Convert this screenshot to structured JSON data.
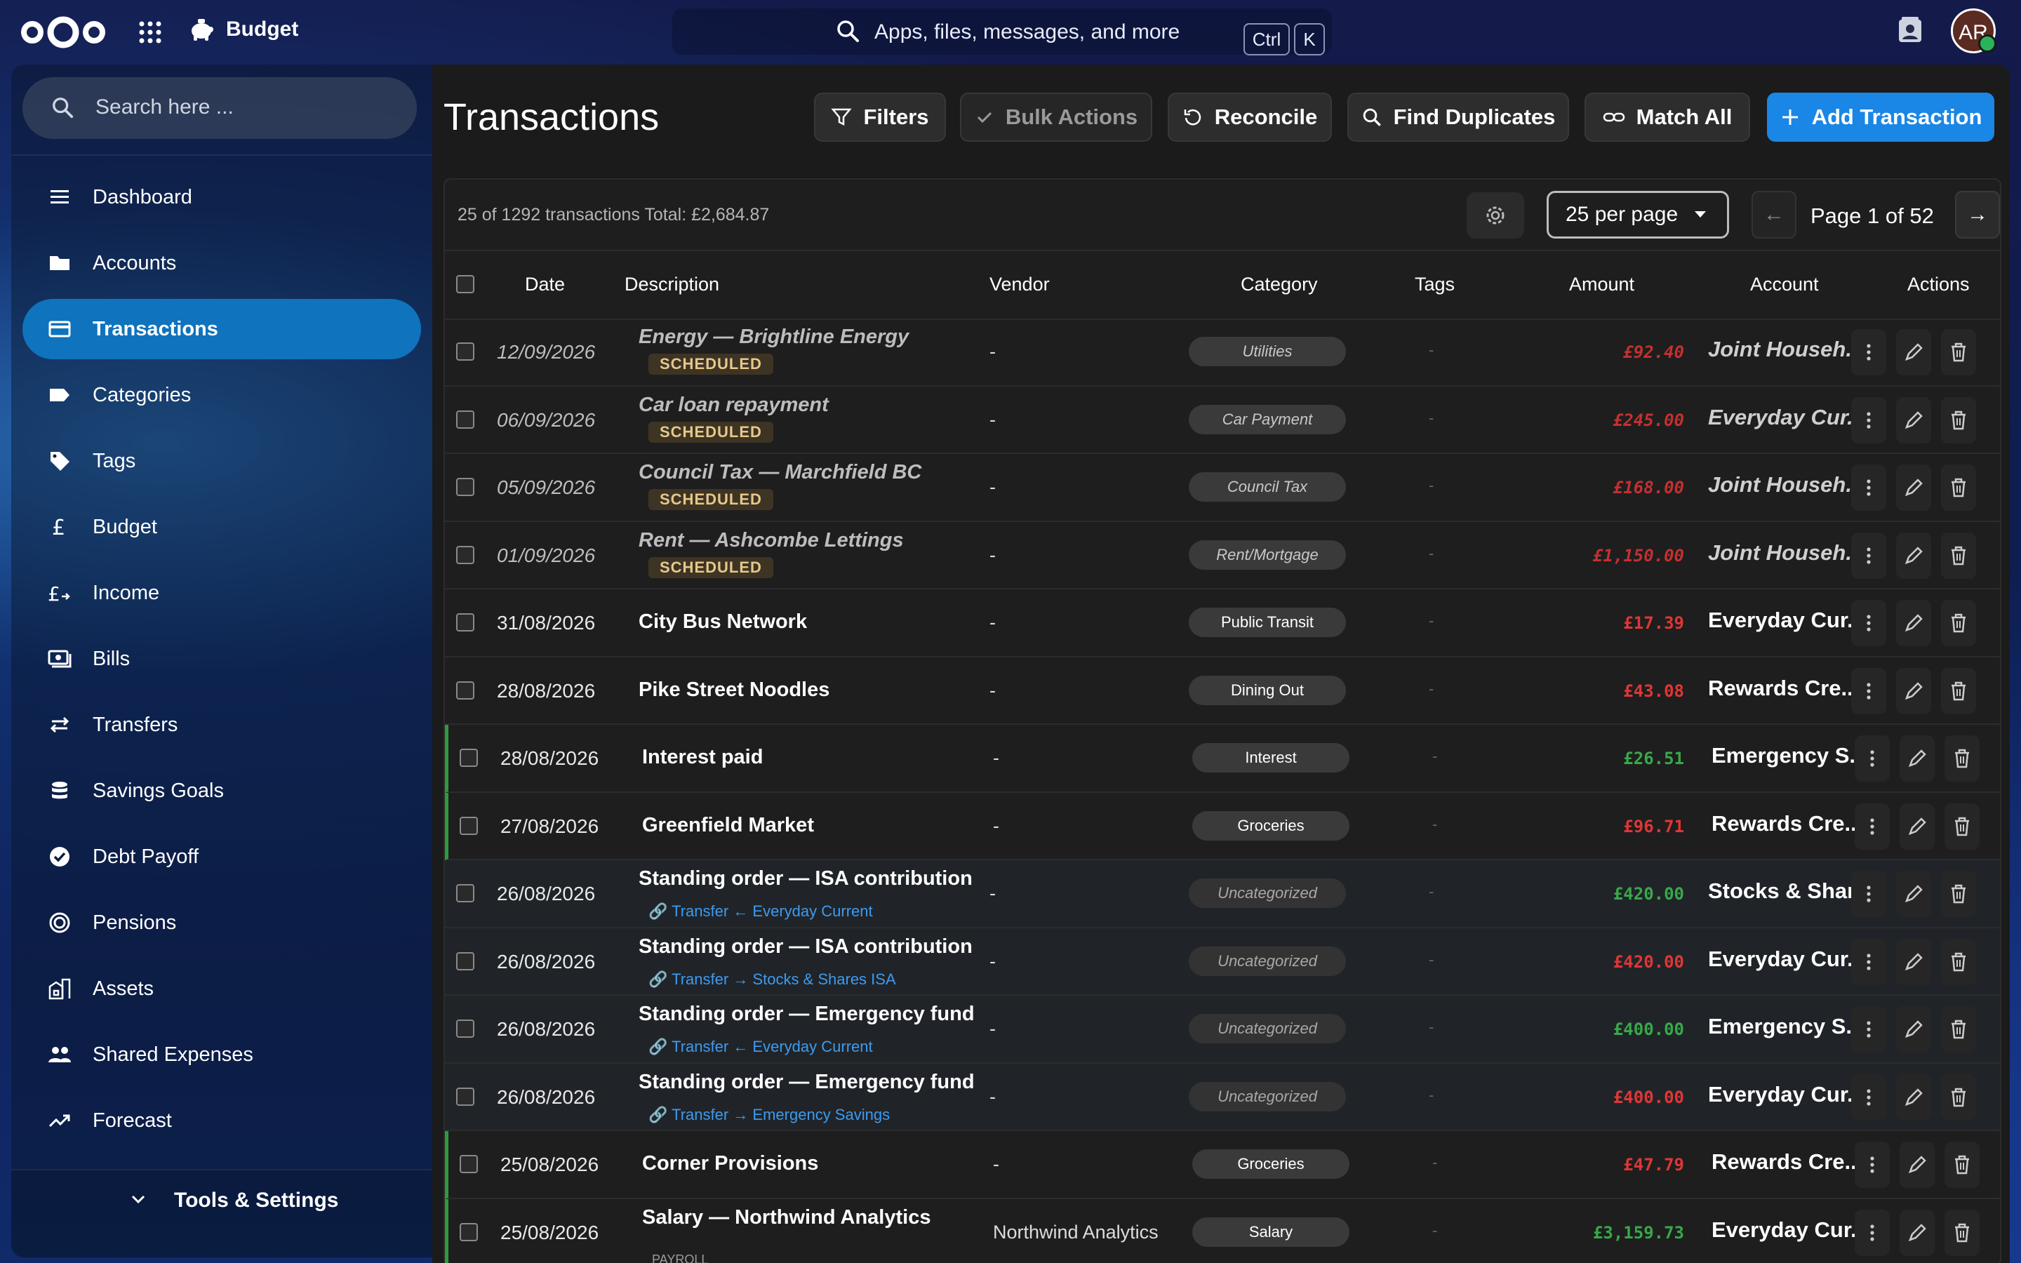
{
  "app": {
    "name": "Budget"
  },
  "global_search": {
    "placeholder": "Apps, files, messages, and more",
    "kbd1": "Ctrl",
    "kbd2": "K"
  },
  "user": {
    "initials": "AR"
  },
  "sidebar": {
    "search_placeholder": "Search here ...",
    "items": [
      {
        "label": "Dashboard",
        "icon": "menu-icon"
      },
      {
        "label": "Accounts",
        "icon": "folder-icon"
      },
      {
        "label": "Transactions",
        "icon": "card-icon",
        "active": true
      },
      {
        "label": "Categories",
        "icon": "label-icon"
      },
      {
        "label": "Tags",
        "icon": "tag-icon"
      },
      {
        "label": "Budget",
        "icon": "pound-icon"
      },
      {
        "label": "Income",
        "icon": "pound-arrow-icon"
      },
      {
        "label": "Bills",
        "icon": "cash-icon"
      },
      {
        "label": "Transfers",
        "icon": "swap-icon"
      },
      {
        "label": "Savings Goals",
        "icon": "coins-icon"
      },
      {
        "label": "Debt Payoff",
        "icon": "check-circle-icon"
      },
      {
        "label": "Pensions",
        "icon": "ring-icon"
      },
      {
        "label": "Assets",
        "icon": "building-icon"
      },
      {
        "label": "Shared Expenses",
        "icon": "people-icon"
      },
      {
        "label": "Forecast",
        "icon": "trend-icon"
      }
    ],
    "footer_label": "Tools & Settings"
  },
  "main": {
    "title": "Transactions",
    "buttons": {
      "filters": "Filters",
      "bulk": "Bulk Actions",
      "reconcile": "Reconcile",
      "duplicates": "Find Duplicates",
      "match": "Match All",
      "add": "Add Transaction"
    },
    "summary": "25 of 1292 transactions   Total: £2,684.87",
    "per_page": "25 per page",
    "page_text": "Page 1 of 52",
    "prev": "←",
    "next": "→",
    "columns": {
      "date": "Date",
      "description": "Description",
      "vendor": "Vendor",
      "category": "Category",
      "tags": "Tags",
      "amount": "Amount",
      "account": "Account",
      "actions": "Actions"
    }
  },
  "rows": [
    {
      "date": "12/09/2026",
      "desc": "Energy — Brightline Energy",
      "badge": "SCHEDULED",
      "vendor": "-",
      "category": "Utilities",
      "tags": "-",
      "amount": "£92.40",
      "sign": "neg",
      "account": "Joint Househ...",
      "kind": "sched"
    },
    {
      "date": "06/09/2026",
      "desc": "Car loan repayment",
      "badge": "SCHEDULED",
      "vendor": "-",
      "category": "Car Payment",
      "tags": "-",
      "amount": "£245.00",
      "sign": "neg",
      "account": "Everyday Cur...",
      "kind": "sched"
    },
    {
      "date": "05/09/2026",
      "desc": "Council Tax — Marchfield BC",
      "badge": "SCHEDULED",
      "vendor": "-",
      "category": "Council Tax",
      "tags": "-",
      "amount": "£168.00",
      "sign": "neg",
      "account": "Joint Househ...",
      "kind": "sched"
    },
    {
      "date": "01/09/2026",
      "desc": "Rent — Ashcombe Lettings",
      "badge": "SCHEDULED",
      "vendor": "-",
      "category": "Rent/Mortgage",
      "tags": "-",
      "amount": "£1,150.00",
      "sign": "neg",
      "account": "Joint Househ...",
      "kind": "sched"
    },
    {
      "date": "31/08/2026",
      "desc": "City Bus Network",
      "vendor": "-",
      "category": "Public Transit",
      "tags": "-",
      "amount": "£17.39",
      "sign": "neg",
      "account": "Everyday Cur...",
      "kind": "normal"
    },
    {
      "date": "28/08/2026",
      "desc": "Pike Street Noodles",
      "vendor": "-",
      "category": "Dining Out",
      "tags": "-",
      "amount": "£43.08",
      "sign": "neg",
      "account": "Rewards Cre...",
      "kind": "normal"
    },
    {
      "date": "28/08/2026",
      "desc": "Interest paid",
      "vendor": "-",
      "category": "Interest",
      "tags": "-",
      "amount": "£26.51",
      "sign": "pos",
      "account": "Emergency S...",
      "kind": "income"
    },
    {
      "date": "27/08/2026",
      "desc": "Greenfield Market",
      "vendor": "-",
      "category": "Groceries",
      "tags": "-",
      "amount": "£96.71",
      "sign": "neg",
      "account": "Rewards Cre...",
      "kind": "income"
    },
    {
      "date": "26/08/2026",
      "desc": "Standing order — ISA contribution",
      "link": "Transfer ← Everyday Current",
      "vendor": "-",
      "category": "Uncategorized",
      "tags": "-",
      "amount": "£420.00",
      "sign": "pos",
      "account": "Stocks & Shar...",
      "kind": "transfer"
    },
    {
      "date": "26/08/2026",
      "desc": "Standing order — ISA contribution",
      "link": "Transfer → Stocks & Shares ISA",
      "vendor": "-",
      "category": "Uncategorized",
      "tags": "-",
      "amount": "£420.00",
      "sign": "neg",
      "account": "Everyday Cur...",
      "kind": "transfer"
    },
    {
      "date": "26/08/2026",
      "desc": "Standing order — Emergency fund",
      "link": "Transfer ← Everyday Current",
      "vendor": "-",
      "category": "Uncategorized",
      "tags": "-",
      "amount": "£400.00",
      "sign": "pos",
      "account": "Emergency S...",
      "kind": "transfer"
    },
    {
      "date": "26/08/2026",
      "desc": "Standing order — Emergency fund",
      "link": "Transfer → Emergency Savings",
      "vendor": "-",
      "category": "Uncategorized",
      "tags": "-",
      "amount": "£400.00",
      "sign": "neg",
      "account": "Everyday Cur...",
      "kind": "transfer"
    },
    {
      "date": "25/08/2026",
      "desc": "Corner Provisions",
      "vendor": "-",
      "category": "Groceries",
      "tags": "-",
      "amount": "£47.79",
      "sign": "neg",
      "account": "Rewards Cre...",
      "kind": "income"
    },
    {
      "date": "25/08/2026",
      "desc": "Salary — Northwind Analytics",
      "sub": "PAYROLL",
      "vendor": "Northwind Analytics",
      "category": "Salary",
      "tags": "-",
      "amount": "£3,159.73",
      "sign": "pos",
      "account": "Everyday Cur...",
      "kind": "income"
    }
  ]
}
